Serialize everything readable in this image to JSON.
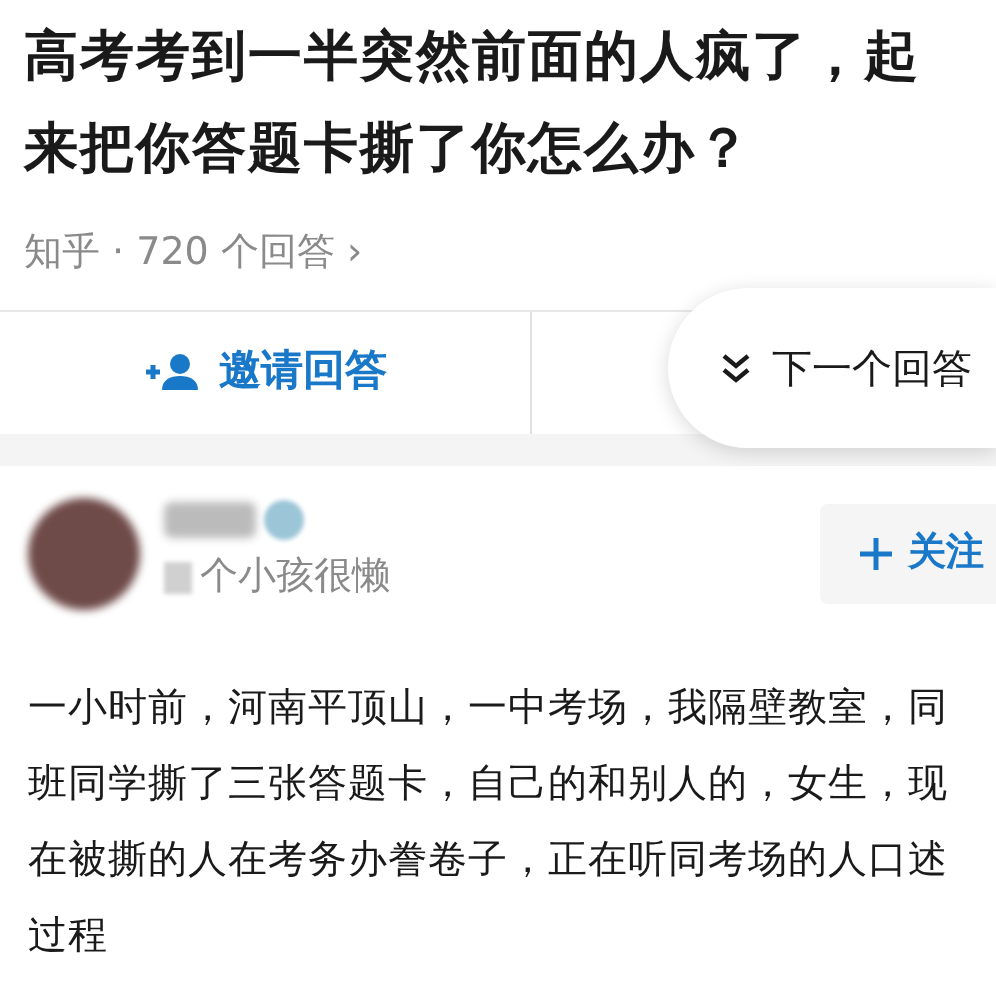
{
  "question": {
    "title": "高考考到一半突然前面的人疯了，起来把你答题卡撕了你怎么办？",
    "source": "知乎 · 720 个回答",
    "chevron": "›"
  },
  "actions": {
    "invite": {
      "label": "邀请回答"
    },
    "next": {
      "label": "下一个回答"
    }
  },
  "author": {
    "bio": "个小孩很懒",
    "follow": {
      "label": "关注"
    }
  },
  "answer": {
    "text": "一小时前，河南平顶山，一中考场，我隔壁教室，同班同学撕了三张答题卡，自己的和别人的，女生，现在被撕的人在考务办誊卷子，正在听同考场的人口述过程"
  }
}
